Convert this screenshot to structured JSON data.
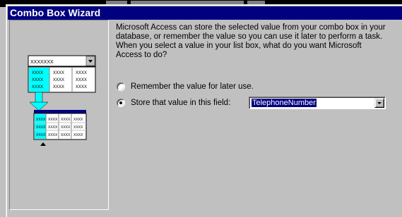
{
  "window": {
    "title": "Combo Box Wizard"
  },
  "instructions": "Microsoft Access can store the selected value from your combo box in your database, or remember the value so you can use it later to perform a task.  When you select a value in your list box, what do you want Microsoft Access to do?",
  "options": [
    {
      "label": "Remember the value for later use.",
      "selected": false
    },
    {
      "label": "Store that value in this field:",
      "selected": true
    }
  ],
  "field_combo": {
    "value": "TelephoneNumber"
  },
  "illustration": {
    "combo_text": "XXXXXXX",
    "grid_cell_text": "XXXX"
  },
  "colors": {
    "titlebar": "#000080",
    "face": "#c0c0c0",
    "highlight_cyan": "#00ffff",
    "selection": "#000080"
  }
}
